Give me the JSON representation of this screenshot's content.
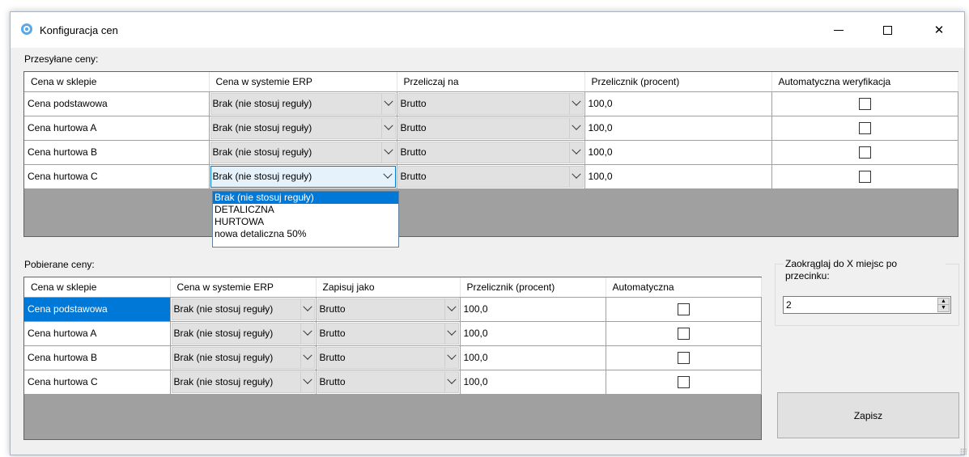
{
  "window": {
    "title": "Konfiguracja cen",
    "icon": "gear-flower-icon",
    "controls": {
      "minimize": "minimize-icon",
      "maximize": "maximize-icon",
      "close": "✕"
    }
  },
  "sent": {
    "label": "Przesyłane ceny:",
    "columns": [
      "Cena w sklepie",
      "Cena w systemie ERP",
      "Przeliczaj na",
      "Przelicznik (procent)",
      "Automatyczna weryfikacja"
    ],
    "rows": [
      {
        "shop": "Cena podstawowa",
        "erp": "Brak (nie stosuj reguły)",
        "convert": "Brutto",
        "factor": "100,0",
        "auto": false
      },
      {
        "shop": "Cena hurtowa A",
        "erp": "Brak (nie stosuj reguły)",
        "convert": "Brutto",
        "factor": "100,0",
        "auto": false
      },
      {
        "shop": "Cena hurtowa B",
        "erp": "Brak (nie stosuj reguły)",
        "convert": "Brutto",
        "factor": "100,0",
        "auto": false
      },
      {
        "shop": "Cena hurtowa C",
        "erp": "Brak (nie stosuj reguły)",
        "convert": "Brutto",
        "factor": "100,0",
        "auto": false
      }
    ],
    "dropdown_options": [
      "Brak (nie stosuj reguły)",
      "DETALICZNA",
      "HURTOWA",
      "nowa detaliczna 50%"
    ]
  },
  "received": {
    "label": "Pobierane ceny:",
    "columns": [
      "Cena w sklepie",
      "Cena w systemie ERP",
      "Zapisuj jako",
      "Przelicznik (procent)",
      "Automatyczna"
    ],
    "rows": [
      {
        "shop": "Cena podstawowa",
        "erp": "Brak (nie stosuj reguły)",
        "save_as": "Brutto",
        "factor": "100,0",
        "auto": false
      },
      {
        "shop": "Cena hurtowa A",
        "erp": "Brak (nie stosuj reguły)",
        "save_as": "Brutto",
        "factor": "100,0",
        "auto": false
      },
      {
        "shop": "Cena hurtowa B",
        "erp": "Brak (nie stosuj reguły)",
        "save_as": "Brutto",
        "factor": "100,0",
        "auto": false
      },
      {
        "shop": "Cena hurtowa C",
        "erp": "Brak (nie stosuj reguły)",
        "save_as": "Brutto",
        "factor": "100,0",
        "auto": false
      }
    ]
  },
  "rounding": {
    "label": "Zaokrąglaj do X miejsc po przecinku:",
    "value": "2"
  },
  "save_button": "Zapisz",
  "colors": {
    "selection": "#0078d7",
    "window_bg": "#f0f0f0",
    "grid_empty": "#a0a0a0"
  }
}
